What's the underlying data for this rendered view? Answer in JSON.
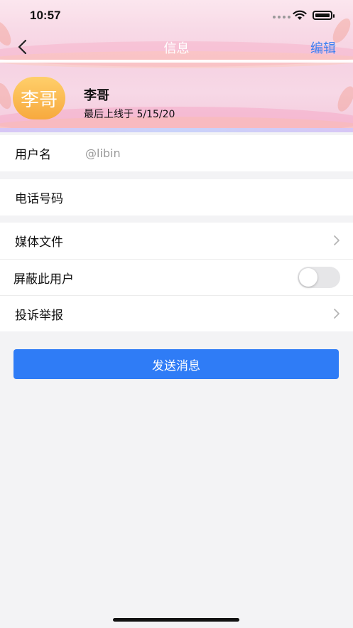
{
  "status_bar": {
    "time": "10:57"
  },
  "nav": {
    "title": "信息",
    "edit_label": "编辑"
  },
  "profile": {
    "avatar_text": "李哥",
    "name": "李哥",
    "last_online": "最后上线于 5/15/20"
  },
  "info": {
    "username_label": "用户名",
    "username_value": "@libin",
    "phone_label": "电话号码"
  },
  "actions": {
    "media_label": "媒体文件",
    "block_label": "屏蔽此用户",
    "block_enabled": false,
    "report_label": "投诉举报"
  },
  "send_button_label": "发送消息",
  "colors": {
    "accent": "#2f7cf6",
    "edit": "#3a7ff2",
    "avatar_top": "#ffcf6a",
    "avatar_bottom": "#f7a93e"
  }
}
